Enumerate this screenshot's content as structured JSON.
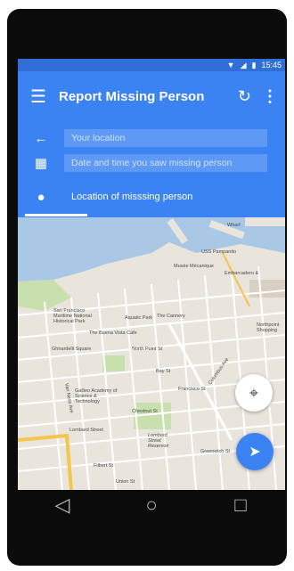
{
  "status_bar": {
    "time": "15:45",
    "wifi_icon": "wifi-icon",
    "signal_icon": "signal-icon",
    "battery_icon": "battery-icon"
  },
  "app_bar": {
    "title": "Report Missing Person",
    "menu_icon": "menu-icon",
    "refresh_icon": "refresh-icon",
    "more_icon": "more-vert-icon"
  },
  "form": {
    "your_location": {
      "placeholder": "Your location",
      "icon": "arrow-back-icon"
    },
    "date_time": {
      "placeholder": "Date and time you saw missing person",
      "icon": "calendar-icon"
    },
    "missing_location": {
      "label": "Location of misssing person",
      "icon": "location-pin-icon"
    }
  },
  "map": {
    "labels": {
      "wharf": "Wharf",
      "uss_pampanito": "USS Pampanito",
      "musee_mecanique": "Musée Mécanique",
      "embarcadero": "Embarcadero &",
      "maritime": "San Francisco Maritime National Historical Park",
      "aquatic_park": "Aquatic Park",
      "cannery": "The Cannery",
      "buena_vista": "The Buena Vista Cafe",
      "ghirardelli": "Ghirardelli Square",
      "north_point": "North Point St",
      "bay_st": "Bay St",
      "francisco_st": "Francisco St",
      "chestnut_st": "Chestnut St",
      "lombard": "Lombard Street",
      "lombard_reservoir": "Lombard Street Reservoir",
      "greenwich": "Greenwich St",
      "filbert": "Filbert St",
      "union": "Union St",
      "northpoint_shopping": "Northpoint Shopping",
      "galileo": "Galileo Academy of Science & Technology",
      "columbus": "Columbus Ave",
      "van_ness": "Van Ness Ave"
    }
  },
  "fabs": {
    "my_location_icon": "my-location-icon",
    "navigate_icon": "navigation-arrow-icon"
  },
  "nav_bar": {
    "back_icon": "back-triangle-icon",
    "home_icon": "home-circle-icon",
    "recents_icon": "recents-square-icon"
  }
}
